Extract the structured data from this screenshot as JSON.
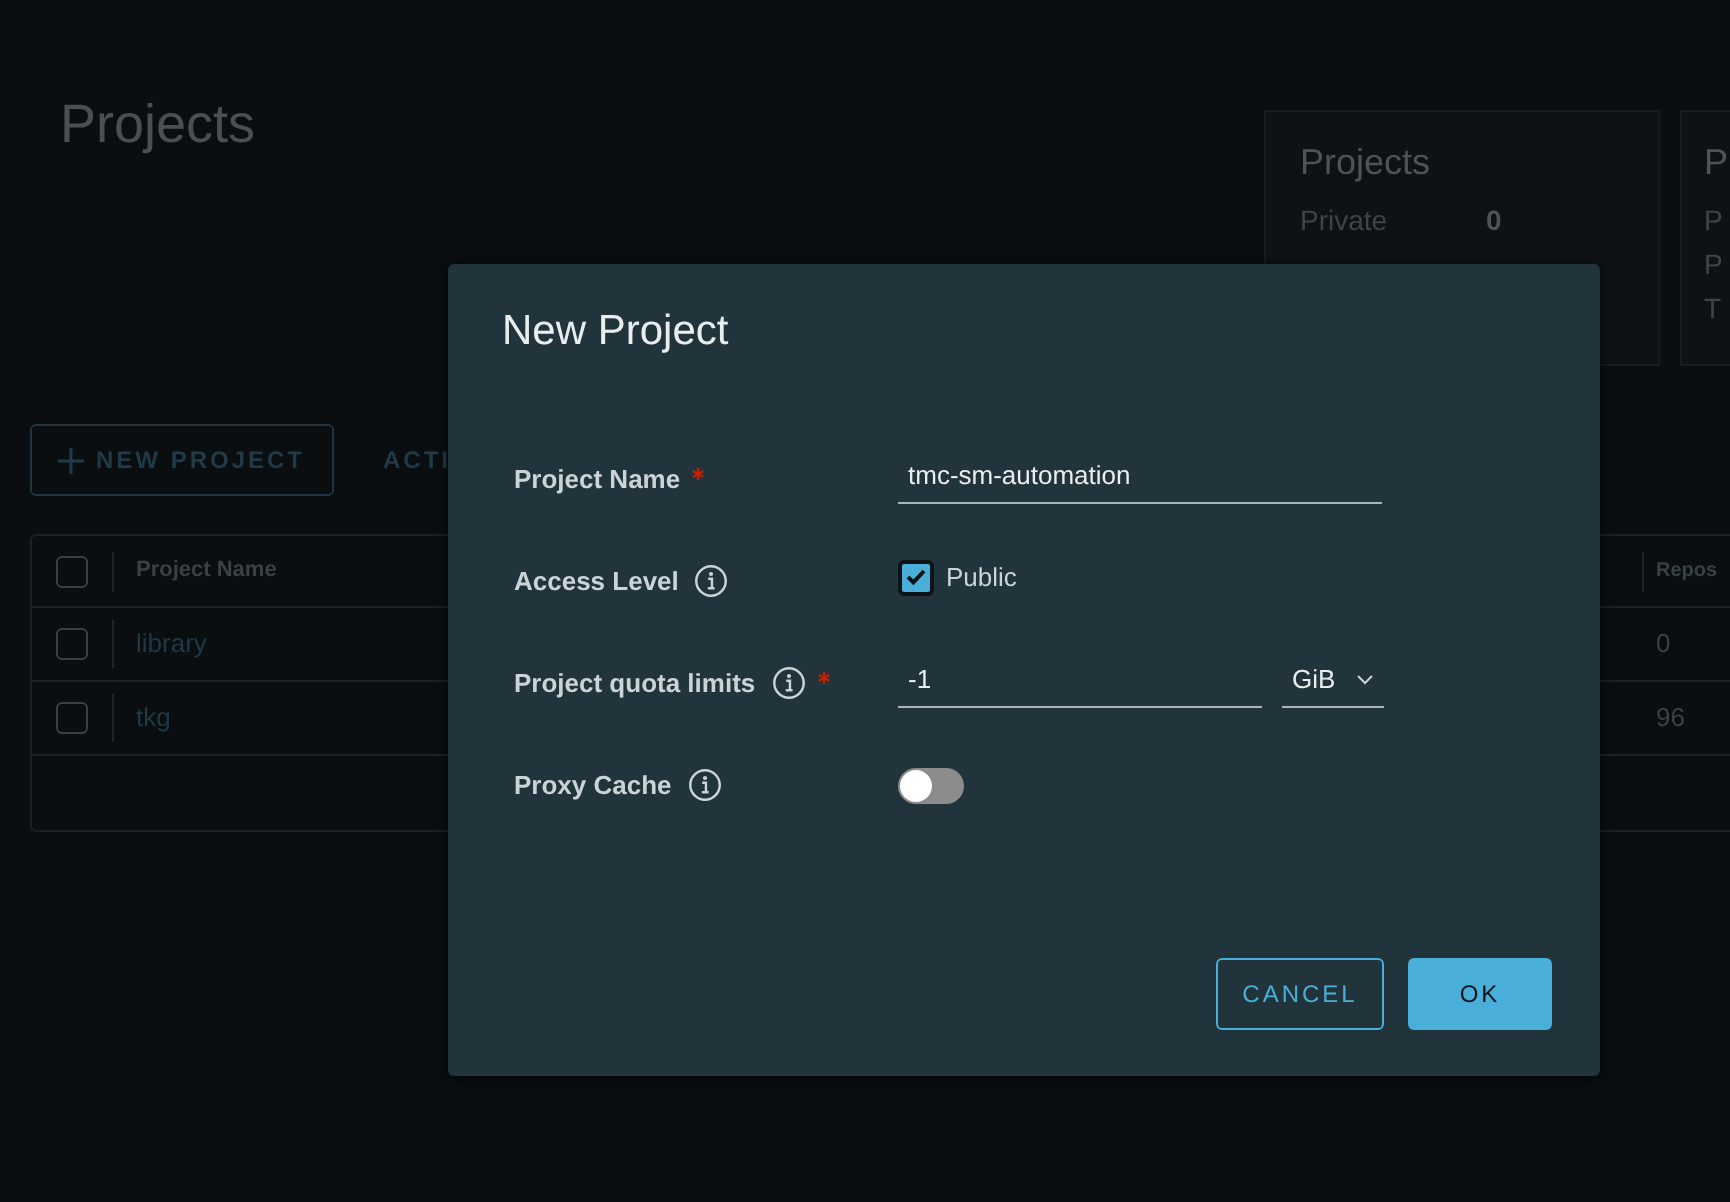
{
  "page": {
    "title": "Projects"
  },
  "summary_cards": [
    {
      "title": "Projects",
      "rows": [
        {
          "label": "Private",
          "value": "0"
        }
      ]
    },
    {
      "title": "P",
      "rows": [
        {
          "label": "P"
        },
        {
          "label": "P"
        },
        {
          "label": "T"
        }
      ]
    }
  ],
  "toolbar": {
    "buttons": [
      {
        "label": "NEW PROJECT",
        "kind": "outline"
      },
      {
        "label": "ACTI",
        "kind": "flat"
      }
    ]
  },
  "table": {
    "columns": [
      "Project Name",
      "Repos"
    ],
    "header_checked": false,
    "rows": [
      {
        "name": "library",
        "repos": "0",
        "checked": false
      },
      {
        "name": "tkg",
        "repos": "96",
        "checked": false
      }
    ]
  },
  "dialog": {
    "title": "New Project",
    "fields": [
      {
        "kind": "text",
        "label": "Project Name",
        "required": true,
        "info": false,
        "value": "tmc-sm-automation"
      },
      {
        "kind": "checkbox",
        "label": "Access Level",
        "required": false,
        "info": true,
        "checked": true,
        "option": "Public"
      },
      {
        "kind": "quota",
        "label": "Project quota limits",
        "required": true,
        "info": true,
        "value": "-1",
        "unit": "GiB"
      },
      {
        "kind": "toggle",
        "label": "Proxy Cache",
        "required": false,
        "info": true,
        "on": false
      }
    ],
    "buttons": [
      {
        "label": "CANCEL",
        "kind": "outline"
      },
      {
        "label": "OK",
        "kind": "primary"
      }
    ]
  }
}
